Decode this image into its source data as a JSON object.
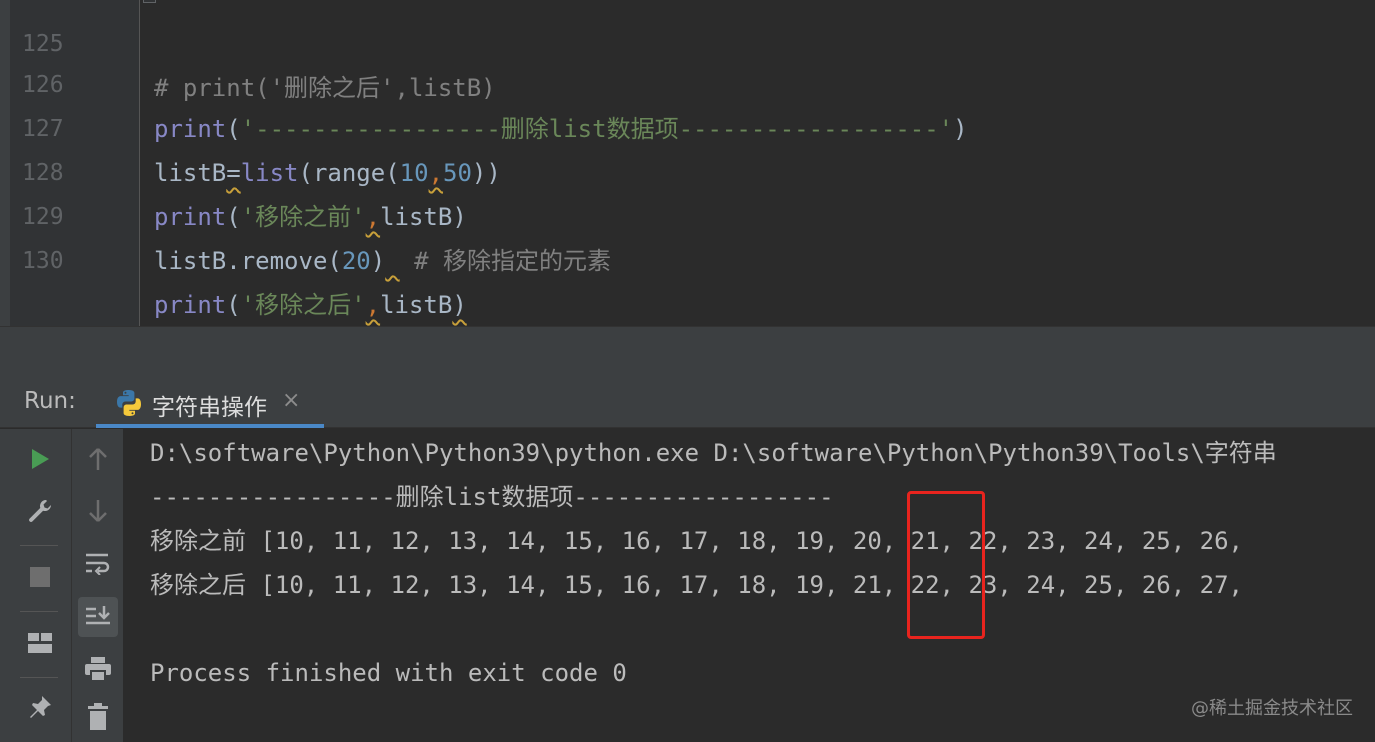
{
  "editor": {
    "partial_top_line": "# print('删除之后',listB)",
    "lines": [
      {
        "number": "126",
        "print": "print",
        "open": "(",
        "string": "'-----------------删除list数据项------------------'",
        "close": ")"
      },
      {
        "number": "127",
        "var": "listB",
        "eq": "=",
        "list": "list",
        "open": "(",
        "range": "range",
        "open2": "(",
        "a": "10",
        "comma": ",",
        "b": "50",
        "close": "))"
      },
      {
        "number": "128",
        "print": "print",
        "open": "(",
        "string": "'移除之前'",
        "comma": ",",
        "var": "listB",
        "close": ")"
      },
      {
        "number": "129",
        "call": "listB.remove",
        "open": "(",
        "arg": "20",
        "close": ")",
        "comment": "# 移除指定的元素"
      },
      {
        "number": "130",
        "print": "print",
        "open": "(",
        "string": "'移除之后'",
        "comma": ",",
        "var": "listB",
        "close": ")"
      }
    ]
  },
  "run": {
    "label": "Run:",
    "tab_label": "字符串操作",
    "tab_close": "×"
  },
  "console": {
    "lines": [
      "D:\\software\\Python\\Python39\\python.exe D:\\software\\Python\\Python39\\Tools\\字符串",
      "-----------------删除list数据项------------------",
      "移除之前 [10, 11, 12, 13, 14, 15, 16, 17, 18, 19, 20, 21, 22, 23, 24, 25, 26,",
      "移除之后 [10, 11, 12, 13, 14, 15, 16, 17, 18, 19, 21, 22, 23, 24, 25, 26, 27,",
      "",
      "Process finished with exit code 0"
    ]
  },
  "toolbar": {
    "left_icons": [
      "run-icon",
      "wrench-icon",
      "stop-icon",
      "layout-icon",
      "pin-icon"
    ],
    "mid_icons": [
      "arrow-up-icon",
      "arrow-down-icon",
      "soft-wrap-icon",
      "scroll-to-end-icon",
      "print-icon",
      "trash-icon"
    ]
  },
  "colors": {
    "accent": "#4a88c7",
    "highlight": "#e8241e",
    "run_green": "#499c54"
  },
  "watermark": "@稀土掘金技术社区"
}
